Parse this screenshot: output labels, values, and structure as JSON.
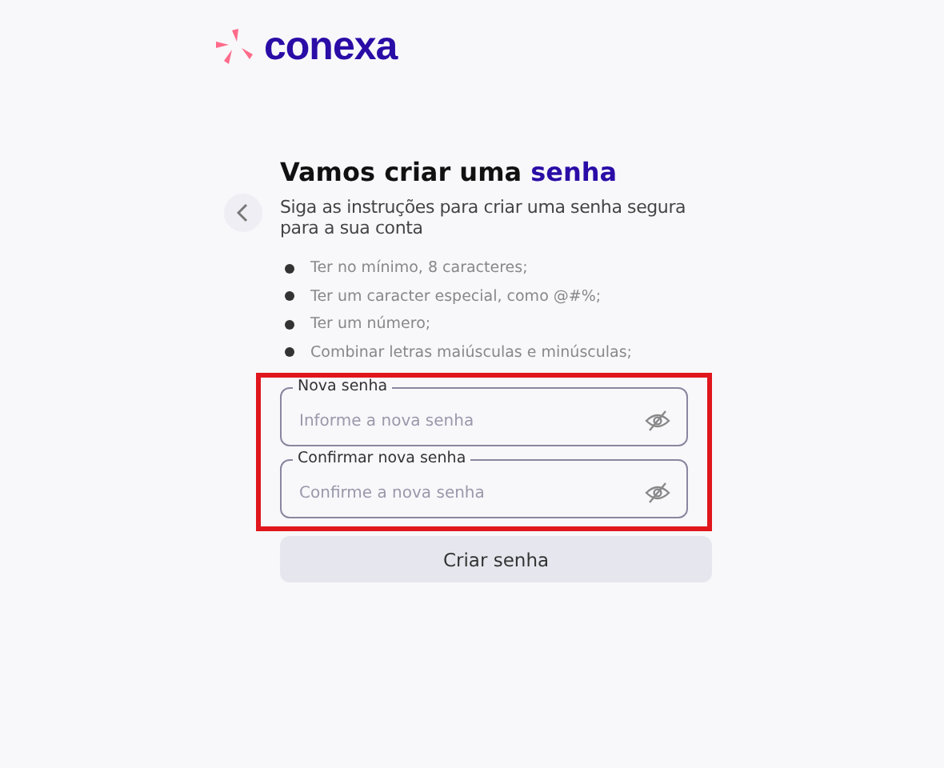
{
  "logo": {
    "text": "conexa"
  },
  "title": "Vamos criar uma **senha**",
  "subtitle": "Siga as instruções para criar uma senha segura para a sua conta",
  "requirements": [
    "Ter no mínimo, 8 caracteres;",
    "Ter um caracter especial, como @#%;",
    "Ter um número;",
    "Combinar letras maiúsculas e minúsculas;"
  ],
  "fields_highlighted": true,
  "fields": [
    {
      "label": "Nova senha",
      "placeholder": "Informe a nova senha"
    },
    {
      "label": "Confirmar nova senha",
      "placeholder": "Confirme a nova senha"
    }
  ],
  "submit": {
    "label": "Criar senha",
    "disabled": true
  }
}
